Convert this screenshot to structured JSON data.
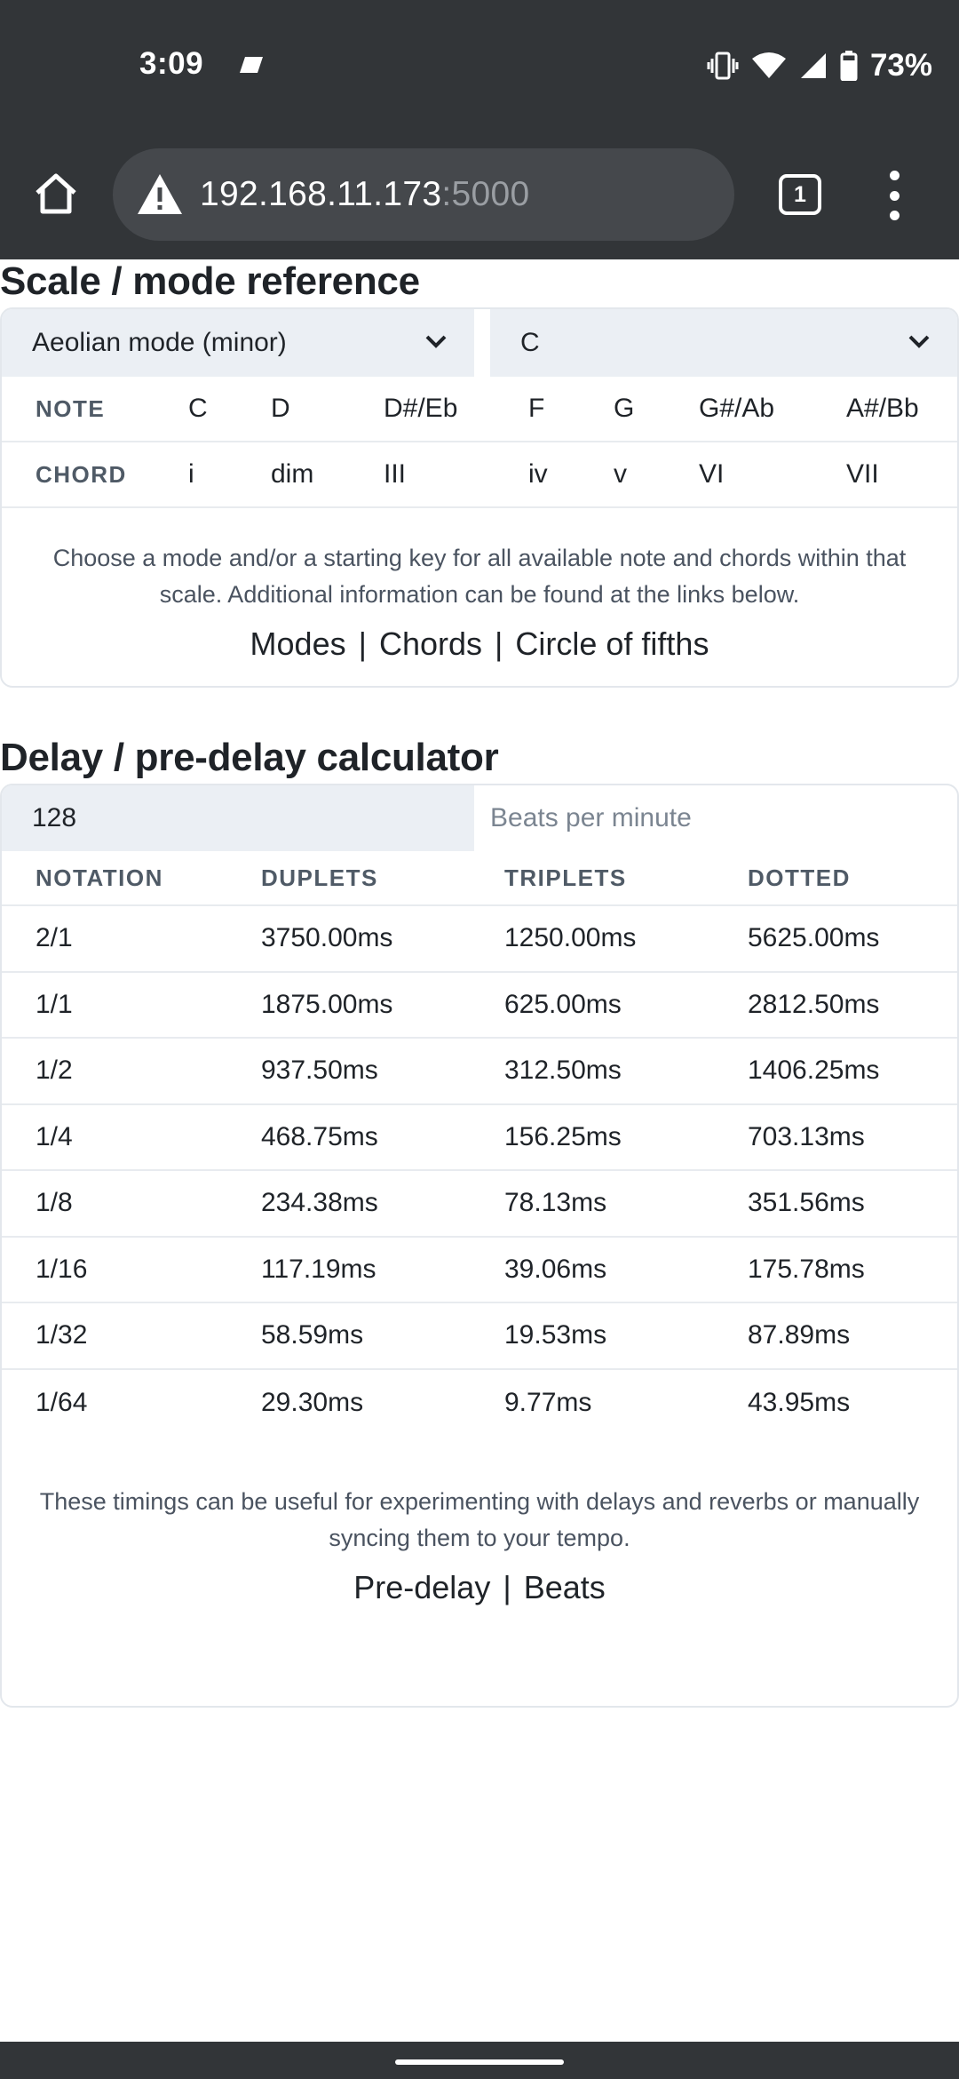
{
  "status_bar": {
    "time": "3:09",
    "battery": "73%",
    "icons": [
      "cast-icon",
      "vibrate-icon",
      "wifi-icon",
      "signal-icon",
      "battery-icon"
    ]
  },
  "browser": {
    "url_host": "192.168.11.173",
    "url_port": ":5000",
    "tab_count": "1",
    "icons": [
      "home-icon",
      "warning-icon",
      "tabs-icon",
      "more-vert-icon"
    ]
  },
  "scale": {
    "title": "Scale / mode reference",
    "mode_select": "Aeolian mode (minor)",
    "key_select": "C",
    "note_header": "NOTE",
    "chord_header": "CHORD",
    "notes": [
      "C",
      "D",
      "D#/Eb",
      "F",
      "G",
      "G#/Ab",
      "A#/Bb"
    ],
    "chords": [
      "i",
      "dim",
      "III",
      "iv",
      "v",
      "VI",
      "VII"
    ],
    "description": "Choose a mode and/or a starting key for all available note and chords within that scale. Additional information can be found at the links below.",
    "links": [
      "Modes",
      "Chords",
      "Circle of fifths"
    ],
    "separator": "|"
  },
  "delay": {
    "title": "Delay / pre-delay calculator",
    "bpm_value": "128",
    "bpm_label": "Beats per minute",
    "headers": [
      "NOTATION",
      "DUPLETS",
      "TRIPLETS",
      "DOTTED"
    ],
    "rows": [
      [
        "2/1",
        "3750.00ms",
        "1250.00ms",
        "5625.00ms"
      ],
      [
        "1/1",
        "1875.00ms",
        "625.00ms",
        "2812.50ms"
      ],
      [
        "1/2",
        "937.50ms",
        "312.50ms",
        "1406.25ms"
      ],
      [
        "1/4",
        "468.75ms",
        "156.25ms",
        "703.13ms"
      ],
      [
        "1/8",
        "234.38ms",
        "78.13ms",
        "351.56ms"
      ],
      [
        "1/16",
        "117.19ms",
        "39.06ms",
        "175.78ms"
      ],
      [
        "1/32",
        "58.59ms",
        "19.53ms",
        "87.89ms"
      ],
      [
        "1/64",
        "29.30ms",
        "9.77ms",
        "43.95ms"
      ]
    ],
    "description": "These timings can be useful for experimenting with delays and reverbs or manually syncing them to your tempo.",
    "links": [
      "Pre-delay",
      "Beats"
    ],
    "separator": "|"
  },
  "colors": {
    "chrome": "#323538",
    "url_bar": "#45484c",
    "select_bg": "#ebeff4",
    "border": "#e3e7ec",
    "header_text": "#4f5a66"
  }
}
